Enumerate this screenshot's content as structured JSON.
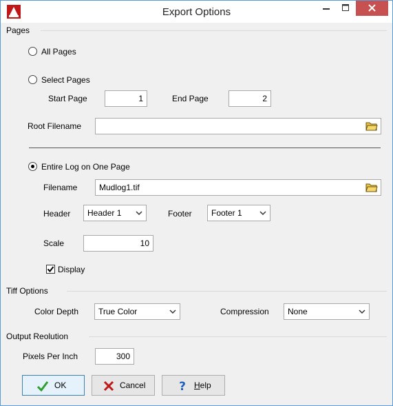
{
  "window": {
    "title": "Export Options",
    "app_icon": "lfb-logo-icon",
    "controls": [
      "minimize-icon",
      "maximize-icon",
      "close-icon"
    ]
  },
  "pages": {
    "section_title": "Pages",
    "all_pages_label": "All Pages",
    "select_pages_label": "Select Pages",
    "start_page_label": "Start Page",
    "start_page_value": "1",
    "end_page_label": "End Page",
    "end_page_value": "2",
    "root_filename_label": "Root Filename",
    "root_filename_value": "",
    "entire_log_label": "Entire Log on One Page",
    "selected_option": "entire_log",
    "filename_label": "Filename",
    "filename_value": "Mudlog1.tif",
    "header_label": "Header",
    "header_value": "Header 1",
    "footer_label": "Footer",
    "footer_value": "Footer 1",
    "scale_label": "Scale",
    "scale_value": "10",
    "display_label": "Display",
    "display_checked": true
  },
  "tiff": {
    "section_title": "Tiff Options",
    "color_depth_label": "Color Depth",
    "color_depth_value": "True Color",
    "compression_label": "Compression",
    "compression_value": "None"
  },
  "output": {
    "section_title": "Output Reolution",
    "ppi_label": "Pixels Per Inch",
    "ppi_value": "300"
  },
  "buttons": {
    "ok_label": "OK",
    "cancel_label": "Cancel",
    "help_label": "Help",
    "help_mnemonic": "H",
    "help_rest": "elp"
  },
  "colors": {
    "close_button": "#c75050",
    "ok_check": "#2e9e2e",
    "cancel_x": "#c01818",
    "help_q": "#1f5fbf"
  }
}
